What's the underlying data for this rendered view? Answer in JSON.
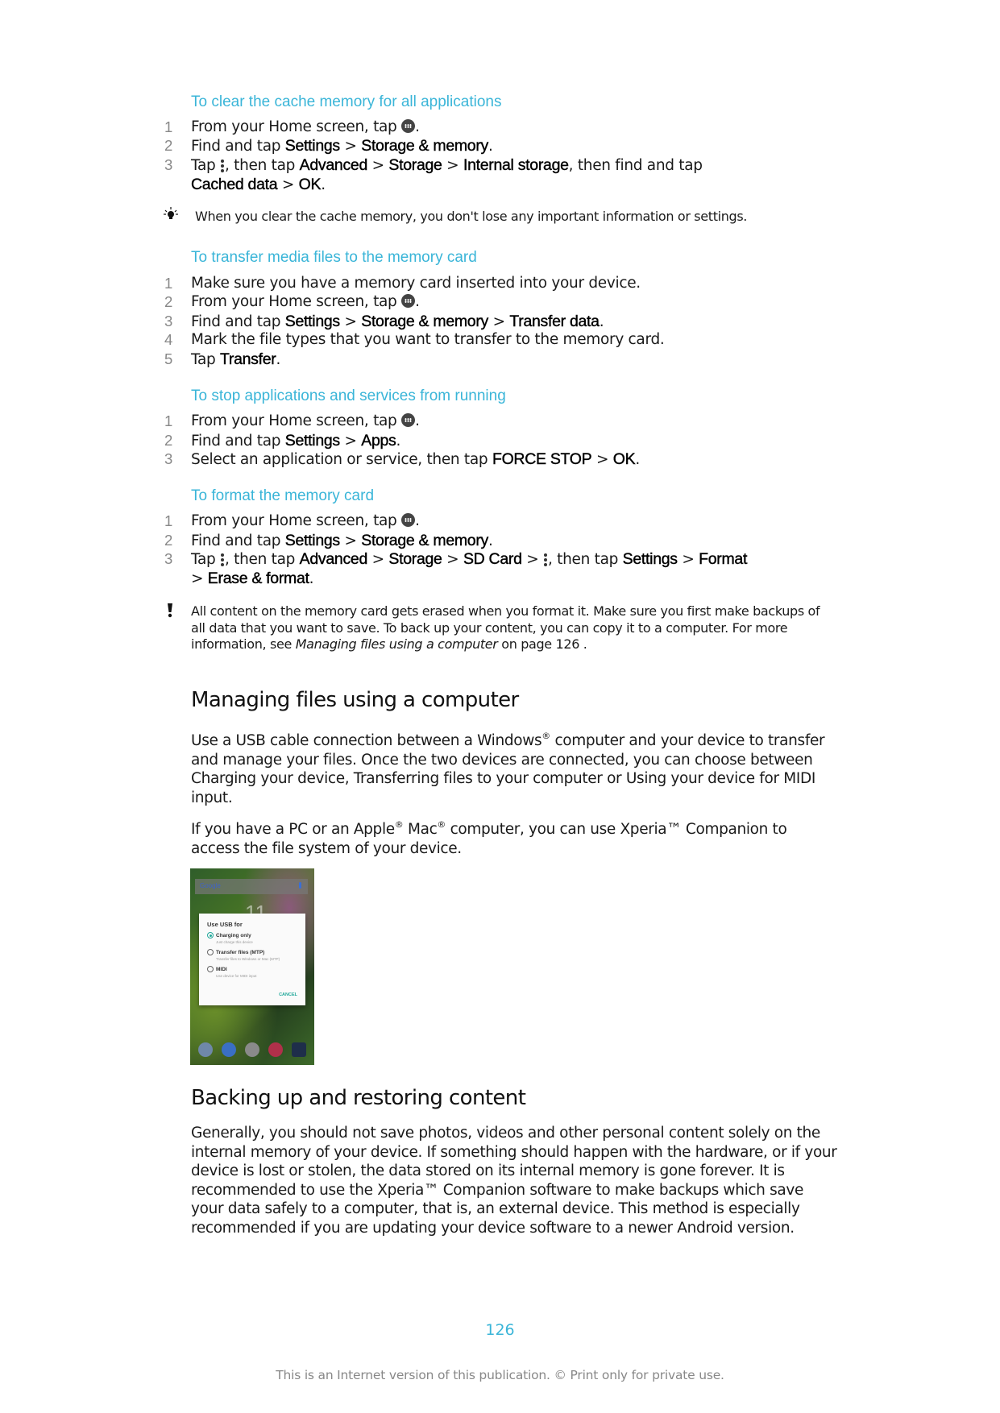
{
  "sections": [
    {
      "title": "To clear the cache memory for all applications",
      "steps": [
        {
          "num": "1",
          "pre": "From your Home screen, tap ",
          "icon": "apps-icon",
          "post": "."
        },
        {
          "num": "2",
          "pre": "Find and tap ",
          "b1": "Settings",
          "sep1": " > ",
          "b2": "Storage & memory",
          "post": "."
        },
        {
          "num": "3",
          "pre": "Tap ",
          "icon": "kebab-icon",
          "mid": ", then tap ",
          "b1": "Advanced",
          "sep1": " > ",
          "b2": "Storage",
          "sep2": " > ",
          "b3": "Internal storage",
          "mid2": ", then find and tap",
          "b4": "Cached data",
          "sep3": " > ",
          "b5": "OK",
          "post": "."
        }
      ],
      "tip": "When you clear the cache memory, you don't lose any important information or settings."
    },
    {
      "title": "To transfer media files to the memory card",
      "steps": [
        {
          "num": "1",
          "text": "Make sure you have a memory card inserted into your device."
        },
        {
          "num": "2",
          "pre": "From your Home screen, tap ",
          "icon": "apps-icon",
          "post": "."
        },
        {
          "num": "3",
          "pre": "Find and tap ",
          "b1": "Settings",
          "sep1": " > ",
          "b2": "Storage & memory",
          "sep2": " > ",
          "b3": "Transfer data",
          "post": "."
        },
        {
          "num": "4",
          "text": "Mark the file types that you want to transfer to the memory card."
        },
        {
          "num": "5",
          "pre": "Tap ",
          "b1": "Transfer",
          "post": "."
        }
      ]
    },
    {
      "title": "To stop applications and services from running",
      "steps": [
        {
          "num": "1",
          "pre": "From your Home screen, tap ",
          "icon": "apps-icon",
          "post": "."
        },
        {
          "num": "2",
          "pre": "Find and tap ",
          "b1": "Settings",
          "sep1": " > ",
          "b2": "Apps",
          "post": "."
        },
        {
          "num": "3",
          "pre": "Select an application or service, then tap ",
          "b1": "FORCE STOP",
          "sep1": " > ",
          "b2": "OK",
          "post": "."
        }
      ]
    },
    {
      "title": "To format the memory card",
      "steps": [
        {
          "num": "1",
          "pre": "From your Home screen, tap ",
          "icon": "apps-icon",
          "post": "."
        },
        {
          "num": "2",
          "pre": "Find and tap ",
          "b1": "Settings",
          "sep1": " > ",
          "b2": "Storage & memory",
          "post": "."
        },
        {
          "num": "3",
          "pre": "Tap ",
          "mid": ", then tap ",
          "b1": "Advanced",
          "sep1": " > ",
          "b2": "Storage",
          "sep2": " > ",
          "b3": "SD Card",
          "sep3": " > ",
          "mid2": ", then tap ",
          "b4": "Settings",
          "sep4": " > ",
          "b5": "Format",
          "sep5": "> ",
          "b6": "Erase & format",
          "post": "."
        }
      ],
      "warning": {
        "text": "All content on the memory card gets erased when you format it. Make sure you first make backups of all data that you want to save. To back up your content, you can copy it to a computer. For more information, see ",
        "link": "Managing files using a computer",
        "after": " on page 126 ."
      }
    }
  ],
  "managing": {
    "heading": "Managing files using a computer",
    "p1_a": "Use a USB cable connection between a Windows",
    "reg": "®",
    "p1_b": " computer and your device to transfer and manage your files. Once the two devices are connected, you can choose between Charging your device, Transferring files to your computer or Using your device for MIDI input.",
    "p2_a": "If you have a PC or an Apple",
    "p2_b": " Mac",
    "p2_c": " computer, you can use Xperia™  Companion to access the file system of your device."
  },
  "phone": {
    "search_label": "Google",
    "clock": "11",
    "dialog_title": "Use USB for",
    "options": [
      {
        "label": "Charging only",
        "sub": "Just charge this device",
        "selected": true
      },
      {
        "label": "Transfer files (MTP)",
        "sub": "Transfer files to Windows or Mac (MTP)",
        "selected": false
      },
      {
        "label": "MIDI",
        "sub": "Use device for MIDI input",
        "selected": false
      }
    ],
    "cancel": "CANCEL"
  },
  "backup": {
    "heading": "Backing up and restoring content",
    "body": "Generally, you should not save photos, videos and other personal content solely on the internal memory of your device. If something should happen with the hardware, or if your device is lost or stolen, the data stored on its internal memory is gone forever. It is recommended to use the Xperia™  Companion software to make backups which save your data safely to a computer, that is, an external device. This method is especially recommended if you are updating your device software to a newer Android version."
  },
  "page_number": "126",
  "footer": "This is an Internet version of this publication. © Print only for private use.",
  "colors": {
    "accent": "#3ab5d8",
    "dialog_accent": "#21a89a"
  }
}
